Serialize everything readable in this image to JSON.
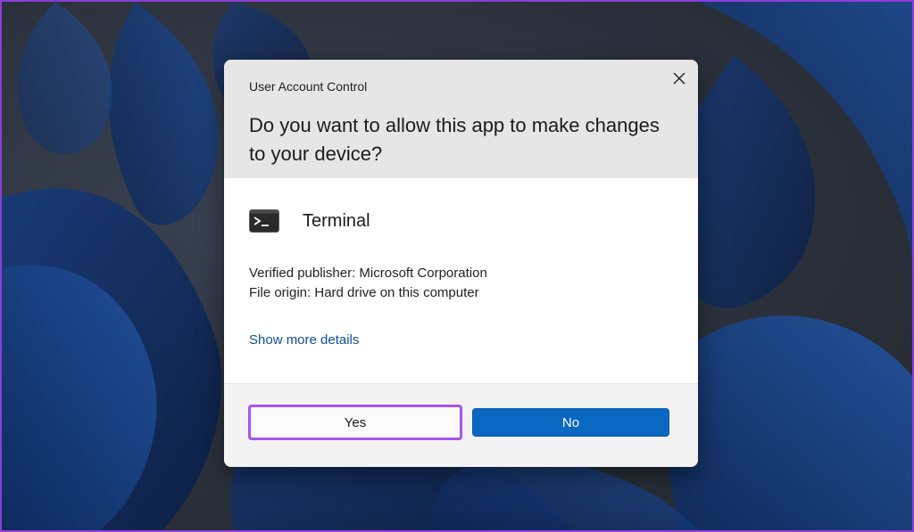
{
  "dialog": {
    "title": "User Account Control",
    "question": "Do you want to allow this app to make changes to your device?",
    "app_name": "Terminal",
    "publisher_line": "Verified publisher: Microsoft Corporation",
    "origin_line": "File origin: Hard drive on this computer",
    "details_link": "Show more details",
    "close_icon": "close-icon",
    "app_icon": "terminal-app-icon"
  },
  "buttons": {
    "yes_label": "Yes",
    "no_label": "No"
  },
  "colors": {
    "highlight_border": "#a855f0",
    "primary_button": "#0a67c2",
    "link": "#0e4f9c",
    "header_background": "#e6e6e6"
  }
}
